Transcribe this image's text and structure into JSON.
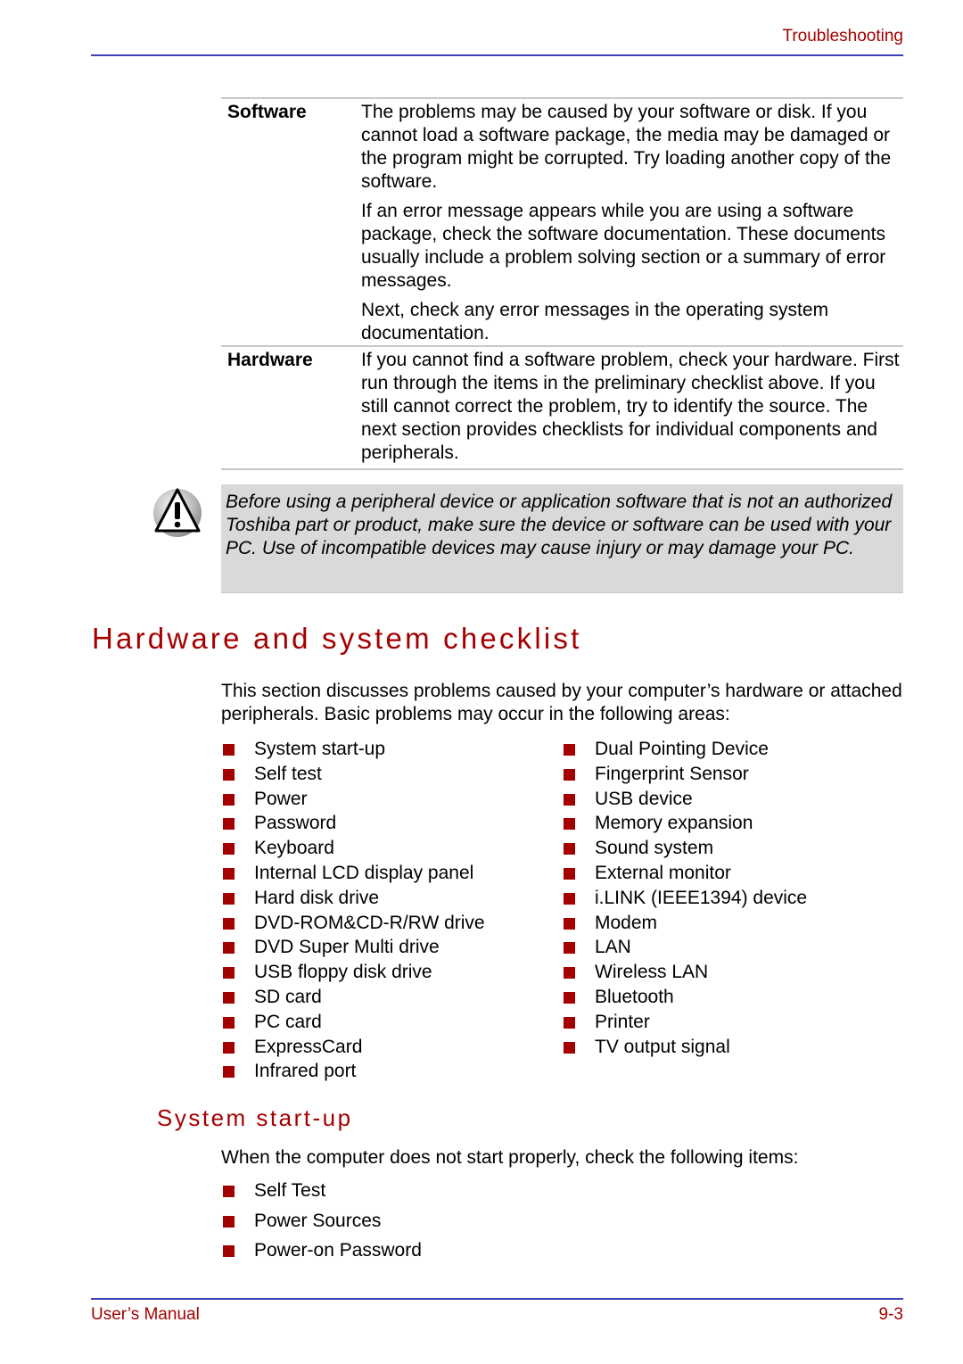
{
  "header": {
    "chapter": "Troubleshooting"
  },
  "definitions": [
    {
      "term": "Software",
      "paragraphs": [
        "The problems may be caused by your software or disk. If you cannot load a software package, the media may be damaged or the program might be corrupted. Try loading another copy of the software.",
        "If an error message appears while you are using a software package, check the software documentation. These documents usually include a problem solving section or a summary of error messages.",
        "Next, check any error messages in the operating system documentation."
      ]
    },
    {
      "term": "Hardware",
      "paragraphs": [
        "If you cannot find a software problem, check your hardware. First run through the items in the preliminary checklist above. If you still cannot correct the problem, try to identify the source. The next section provides checklists for individual components and peripherals."
      ]
    }
  ],
  "caution": {
    "icon": "warning-triangle-icon",
    "text": "Before using a peripheral device or application software that is not an authorized Toshiba part or product, make sure the device or software can be used with your PC. Use of incompatible devices may cause injury or may damage your PC."
  },
  "section": {
    "title": "Hardware and system checklist",
    "intro": "This section discusses problems caused by your computer’s hardware or attached peripherals. Basic problems may occur in the following areas:",
    "areas_col1": [
      "System start-up",
      "Self test",
      "Power",
      "Password",
      "Keyboard",
      "Internal LCD display panel",
      "Hard disk drive",
      "DVD-ROM&CD-R/RW drive",
      "DVD Super Multi drive",
      "USB floppy disk drive",
      "SD card",
      "PC card",
      "ExpressCard",
      "Infrared port"
    ],
    "areas_col2": [
      "Dual Pointing Device",
      "Fingerprint Sensor",
      "USB device",
      "Memory expansion",
      "Sound system",
      "External monitor",
      "i.LINK (IEEE1394) device",
      "Modem",
      "LAN",
      "Wireless LAN",
      "Bluetooth",
      "Printer",
      "TV output signal"
    ]
  },
  "subsection": {
    "title": "System start-up",
    "intro": "When the computer does not start properly, check the following items:",
    "items": [
      "Self Test",
      "Power Sources",
      "Power-on Password"
    ]
  },
  "footer": {
    "left": "User’s Manual",
    "page": "9-3"
  },
  "colors": {
    "accent": "#a50000",
    "rule": "#3b3fb8",
    "caution_bg": "#d9d9d9"
  }
}
